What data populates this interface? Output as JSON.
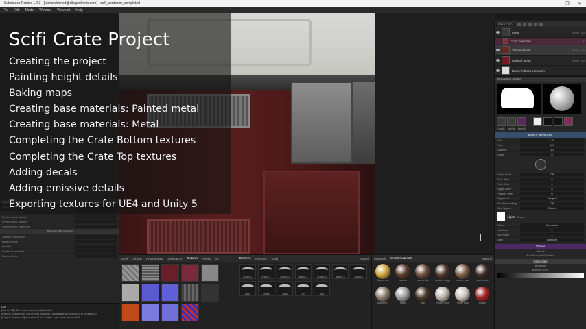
{
  "window": {
    "title": "Substance Painter 1.4.2 - [jeanceddonolt@allegorithmic.com] - scifi_container_completed",
    "controls": [
      "—",
      "❐",
      "✕"
    ]
  },
  "menu": [
    "File",
    "Edit",
    "Mode",
    "Window",
    "Viewport",
    "Help"
  ],
  "overlay": {
    "title": "Scifi Crate Project",
    "chapters": [
      "Creating the project",
      "Painting height details",
      "Baking maps",
      "Creating base materials: Painted metal",
      "Creating base materials: Metal",
      "Completing the Crate Bottom textures",
      "Completing the Crate Top textures",
      "Adding decals",
      "Adding emissive details",
      "Exporting textures for UE4 and Unity 5"
    ]
  },
  "left_panel": {
    "shader_header": "Shader Settings",
    "shader_params_header": "Shader Parameters",
    "rows": [
      "Shader",
      "Environment map",
      "Environment rotation",
      "Environment opacity",
      "Environment exposure",
      "Ambient Occlusion",
      "Height Force",
      "Quality",
      "Emissive intensity",
      "Horizon fade"
    ],
    "log_header": "Log",
    "log_lines": [
      "[Scene 3D] 3D scene successfully loaded",
      "[Project Document] The project has been updated from version 1 to version 10",
      "[Project Document] Creation of the shader was made successful"
    ]
  },
  "layers": {
    "header": "Layers",
    "channel_select": "Base Color",
    "items": [
      {
        "name": "Metal",
        "meta": "Norm 100",
        "type": "folder"
      },
      {
        "name": "Color selection",
        "meta": "",
        "type": "mask",
        "selected": true
      },
      {
        "name": "Tanned Paint",
        "meta": "Norm 100",
        "type": "layer"
      },
      {
        "name": "Painted Metal",
        "meta": "Norm 100",
        "type": "folder"
      },
      {
        "name": "Base Ambient occlusion",
        "meta": "",
        "type": "layer"
      }
    ]
  },
  "properties": {
    "header": "Properties - Paint",
    "tool_labels": [
      "brush",
      "alpha",
      "stencil"
    ],
    "brush_header": "Brush - advanced",
    "brush_rows": [
      {
        "label": "Size",
        "value": "7.75"
      },
      {
        "label": "Flow",
        "value": "100"
      },
      {
        "label": "Spacing",
        "value": "10"
      },
      {
        "label": "Angle",
        "value": "0"
      },
      {
        "label": "Follow Path",
        "value": "Off"
      },
      {
        "label": "Size Jitter",
        "value": "0"
      },
      {
        "label": "Flow Jitter",
        "value": "0"
      },
      {
        "label": "Angle Jitter",
        "value": "0"
      },
      {
        "label": "Position Jitter",
        "value": "0"
      },
      {
        "label": "Alignment",
        "value": "Tangent"
      },
      {
        "label": "Backface culling",
        "value": "Off"
      },
      {
        "label": "Size Space",
        "value": "Object"
      }
    ],
    "alpha_label": "Alpha",
    "alpha_sub": "Shape",
    "shape_rows": [
      {
        "label": "Shape",
        "value": "Gradation"
      },
      {
        "label": "Hardness",
        "value": "1"
      },
      {
        "label": "Size Ratio",
        "value": "1"
      },
      {
        "label": "Seed",
        "value": "Random"
      }
    ],
    "stencil_header": "Stencil",
    "stencil_sub": "Stencil",
    "stencil_note": "No Resource Selected",
    "grayscale_header": "Grayscale",
    "grayscale_sub": "grayscale",
    "grayscale_note": "uniform color"
  },
  "shelf": {
    "textures_tabs": [
      "Shelf",
      "Alphas",
      "Procedurals",
      "Generators",
      "Textures",
      "Filters",
      "Se"
    ],
    "brush_tabs": [
      "Brushes",
      "Particles",
      "Tools",
      "Search"
    ],
    "brush_names": [
      "artistic 1",
      "artistic 2",
      "artistic 3",
      "artistic 4",
      "artistic 5",
      "artistic 6",
      "artistic 7",
      "basic",
      "bristle",
      "chalk",
      "dirt",
      "dots"
    ],
    "materials_tabs": [
      "Materials",
      "Smart materials",
      "Search"
    ],
    "material_names": [
      "Gold armor",
      "Leather",
      "Leather fine",
      "Leather rough",
      "Leather seat",
      "Leather worn",
      "Machinery",
      "Metal",
      "Mud",
      "Plaster bare",
      "Plaster paint",
      "Plastic"
    ],
    "material_colors": [
      "#c9a23a",
      "#5a3a2a",
      "#6a4a3a",
      "#4a3428",
      "#7a5a44",
      "#3a2a20",
      "#8a7a6a",
      "#9a9a9a",
      "#4a3a2a",
      "#b8b0a6",
      "#c8c0b8",
      "#a02020"
    ]
  }
}
